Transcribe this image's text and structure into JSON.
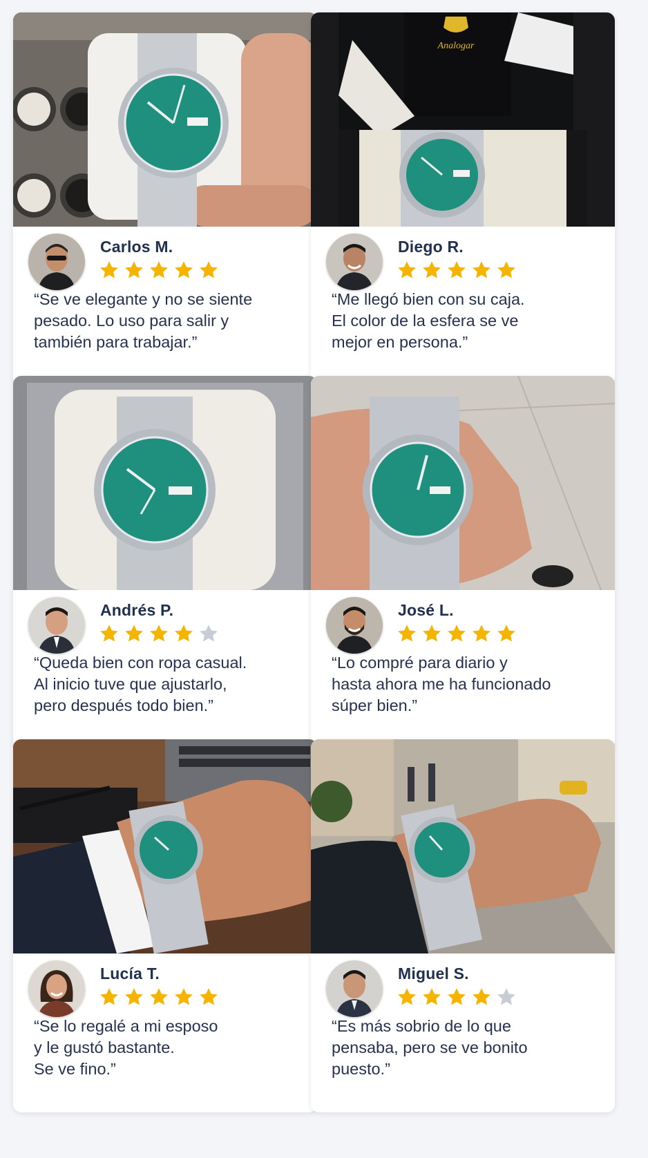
{
  "colors": {
    "star_filled": "#f4b400",
    "star_empty": "#c8ccd4",
    "dial": "#1f8f7e",
    "card_bg": "#ffffff",
    "page_bg": "#f4f5f8",
    "name_text": "#22304f"
  },
  "reviews": [
    {
      "name": "Carlos M.",
      "rating": 5,
      "quote": "“Se ve elegante y no se siente\npesado. Lo uso para salir y\ntambién para trabajar.”",
      "photo_icon": "watch-on-pillow-hand-icon",
      "avatar_icon": "man-sunglasses-avatar"
    },
    {
      "name": "Diego R.",
      "rating": 5,
      "quote": "“Me llegó bien con su caja.\nEl color de la esfera se ve\nmejor en persona.”",
      "photo_icon": "watch-in-box-icon",
      "avatar_icon": "man-smiling-avatar",
      "brand_text": "Analogar"
    },
    {
      "name": "Andrés P.",
      "rating": 4,
      "quote": "“Queda bien con ropa casual.\nAl inicio tuve que ajustarlo,\npero después todo bien.”",
      "photo_icon": "watch-on-pillow-icon",
      "avatar_icon": "man-suit-avatar"
    },
    {
      "name": "José L.",
      "rating": 5,
      "quote": "“Lo compré para diario y\nhasta ahora me ha funcionado\nsúper bien.”",
      "photo_icon": "watch-in-hand-icon",
      "avatar_icon": "man-beard-avatar"
    },
    {
      "name": "Lucía T.",
      "rating": 5,
      "quote": "“Se lo regalé a mi esposo\ny le gustó bastante.\nSe ve fino.”",
      "photo_icon": "watch-on-wrist-desk-icon",
      "avatar_icon": "woman-smiling-avatar"
    },
    {
      "name": "Miguel S.",
      "rating": 4,
      "quote": "“Es más sobrio de lo que\npensaba, pero se ve bonito\npuesto.”",
      "photo_icon": "watch-on-wrist-street-icon",
      "avatar_icon": "man-portrait-avatar"
    }
  ]
}
